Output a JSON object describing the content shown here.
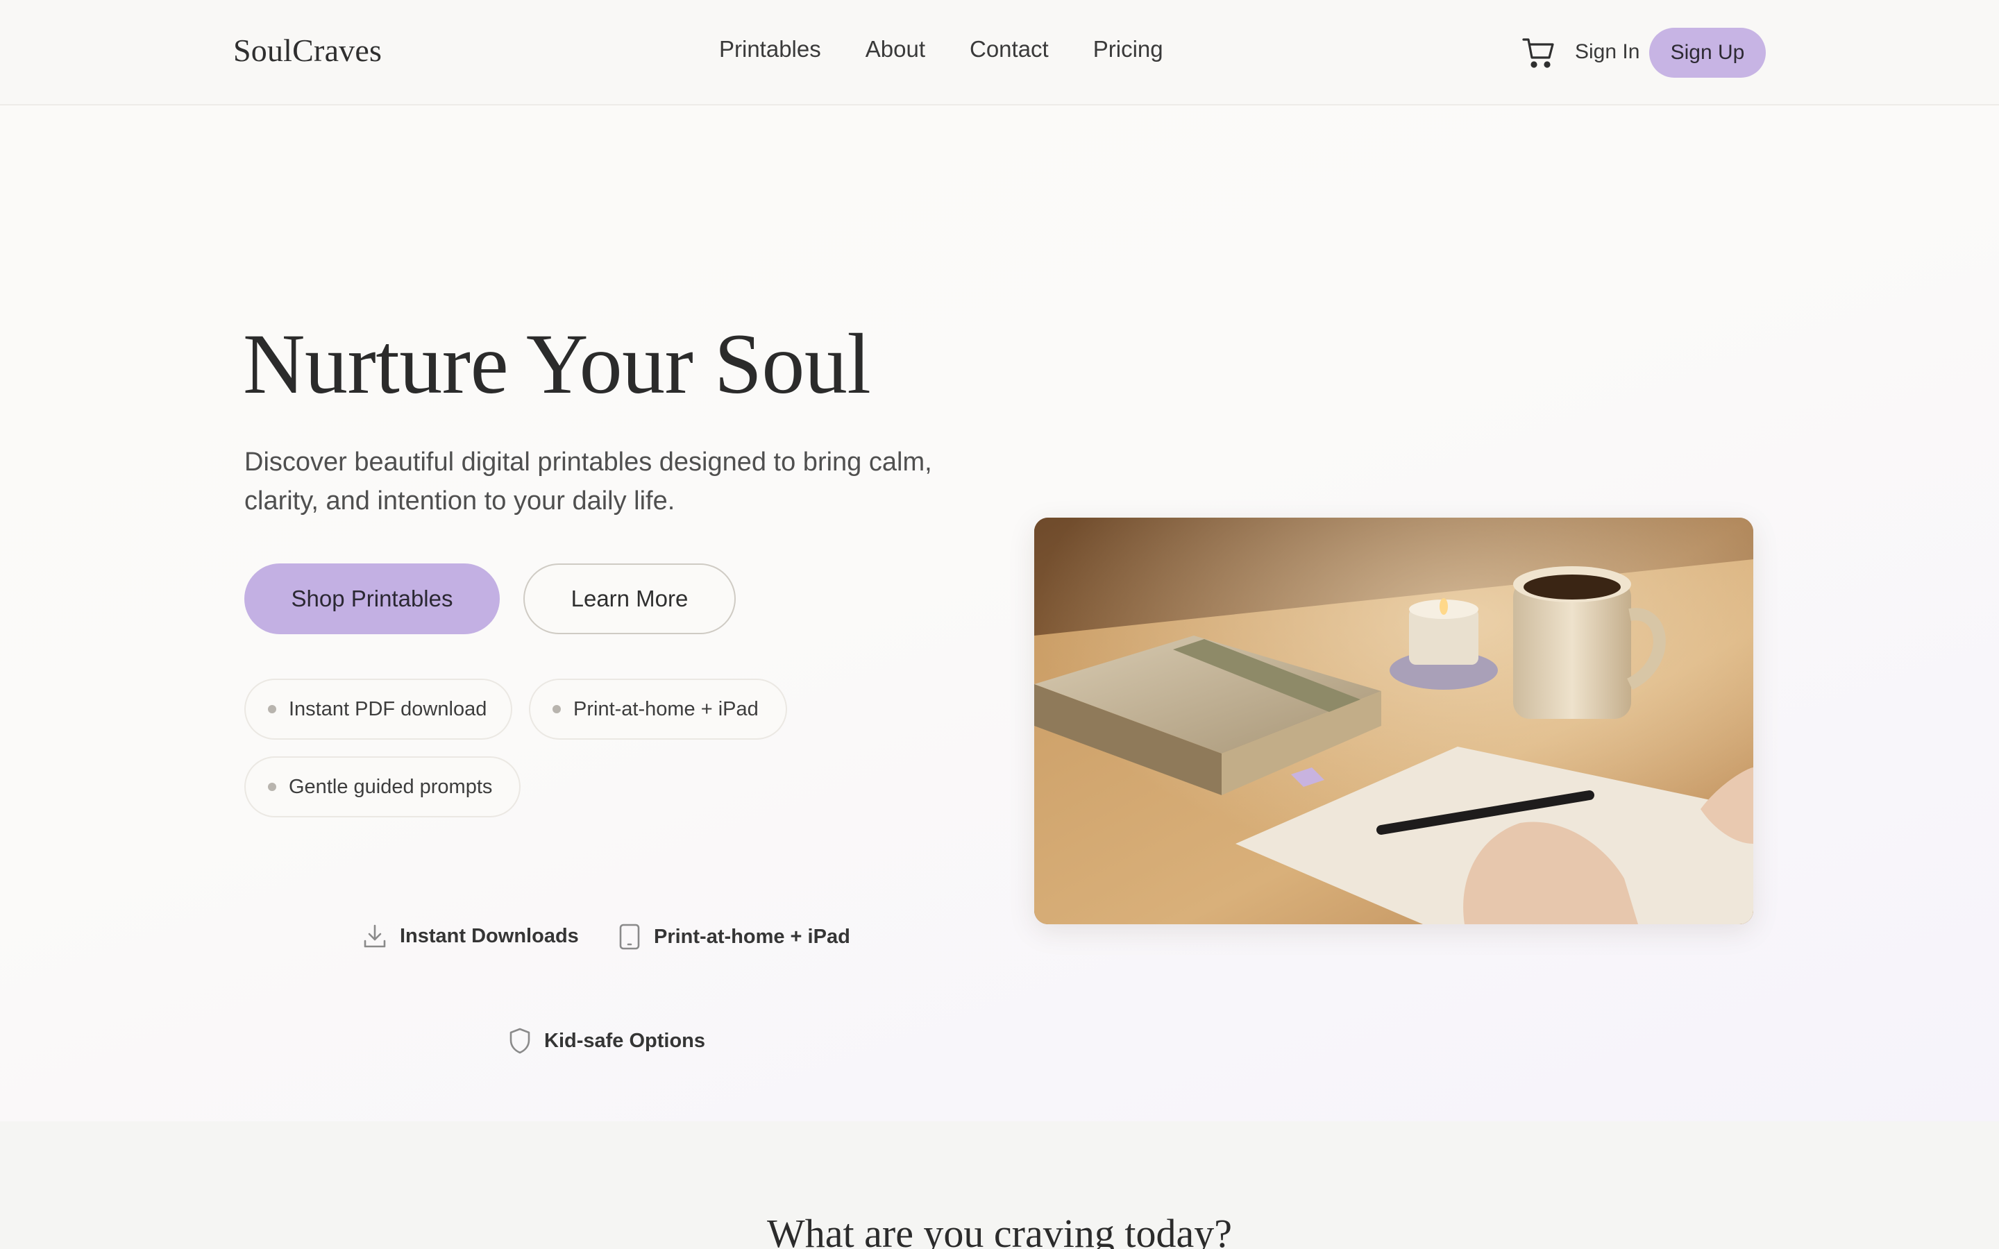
{
  "brand": {
    "name": "SoulCraves",
    "accent": "#c3b0e3"
  },
  "nav": {
    "links": [
      "Printables",
      "About",
      "Contact",
      "Pricing"
    ],
    "cart_icon": "cart-icon",
    "sign_in": "Sign In",
    "sign_up": "Sign Up"
  },
  "hero": {
    "title": "Nurture Your Soul",
    "subtitle": "Discover beautiful digital printables designed to bring calm, clarity, and intention to your daily life.",
    "primary_cta": "Shop Printables",
    "secondary_cta": "Learn More",
    "chips": [
      "Instant PDF download",
      "Print-at-home + iPad",
      "Gentle guided prompts"
    ],
    "features": [
      {
        "icon": "download-icon",
        "label": "Instant Downloads"
      },
      {
        "icon": "tablet-icon",
        "label": "Print-at-home + iPad"
      },
      {
        "icon": "shield-icon",
        "label": "Kid-safe Options"
      }
    ]
  },
  "section2": {
    "title": "What are you craving today?"
  }
}
